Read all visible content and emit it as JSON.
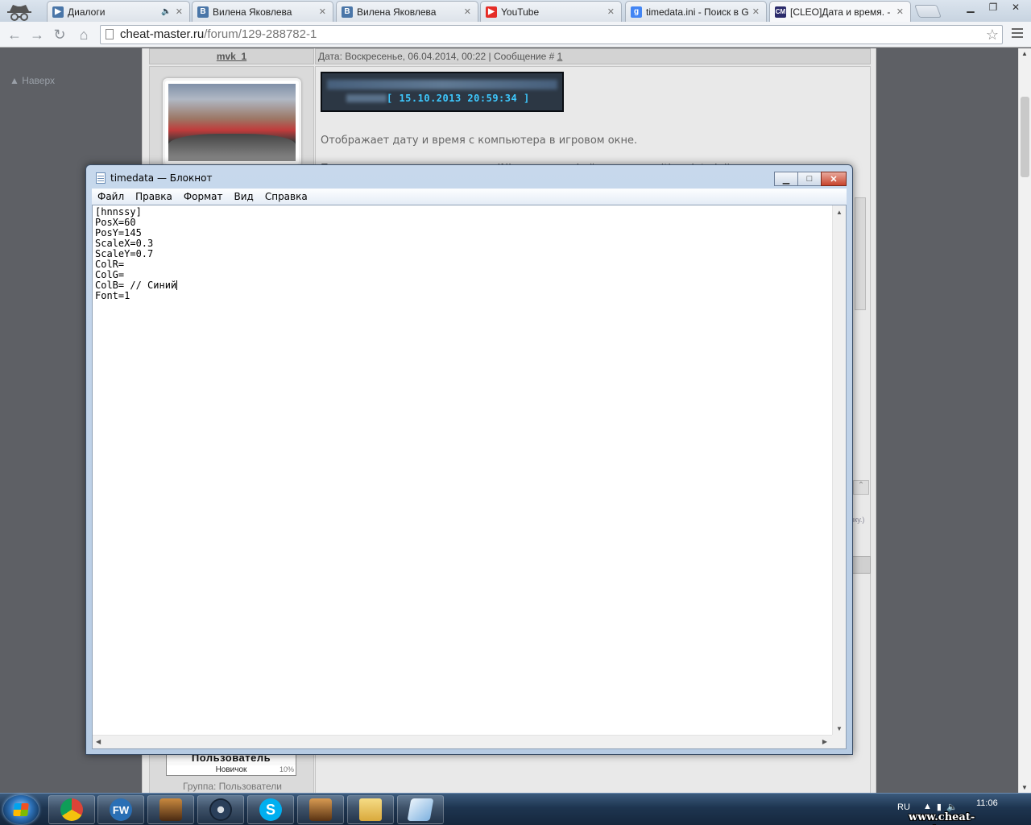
{
  "browser": {
    "tabs": [
      {
        "title": "Диалоги",
        "favicon_letter": "▶",
        "favicon_color": "#4a76a8"
      },
      {
        "title": "Вилена Яковлева",
        "favicon_letter": "В",
        "favicon_color": "#4a76a8"
      },
      {
        "title": "Вилена Яковлева",
        "favicon_letter": "В",
        "favicon_color": "#4a76a8"
      },
      {
        "title": "YouTube",
        "favicon_letter": "▶",
        "favicon_color": "#e52d27"
      },
      {
        "title": "timedata.ini - Поиск в Google",
        "favicon_letter": "g",
        "favicon_color": "#4285f4"
      },
      {
        "title": "[CLEO]Дата и время. - ",
        "favicon_letter": "CM",
        "favicon_color": "#2b2b6b"
      }
    ],
    "url_host": "cheat-master.ru",
    "url_path": "/forum/129-288782-1"
  },
  "page": {
    "top_link": "▲ Наверх",
    "post_author": "mvk_1",
    "post_meta": "Дата: Воскресенье, 06.04.2014, 00:22 | Сообщение # ",
    "post_number": "1",
    "banner_time": "[ 15.10.2013 20:59:34 ]",
    "post_line1": "Отображает дату и время с компьютера в игровом окне.",
    "post_line2": "После первого запуска в папке INI создастся файл настроек (timedata.ini), в котором вы сможете",
    "side_link": "лку.)",
    "rank_title": "Пользователь",
    "rank_level": "Новичок",
    "rank_pct": "10%",
    "group": "Группа: Пользователи"
  },
  "notepad": {
    "title": "timedata — Блокнот",
    "menu": [
      "Файл",
      "Правка",
      "Формат",
      "Вид",
      "Справка"
    ],
    "lines": [
      "[hnnssy]",
      "PosX=60",
      "PosY=145",
      "ScaleX=0.3",
      "ScaleY=0.7",
      "ColR=",
      "ColG=",
      "ColB= // Синий",
      "Font=1"
    ]
  },
  "taskbar": {
    "apps": [
      {
        "name": "chrome",
        "color": "#db4437"
      },
      {
        "name": "fw",
        "color": "#2a6fb5"
      },
      {
        "name": "gta-sa-1",
        "color": "#6b4a2a"
      },
      {
        "name": "steam",
        "color": "#2a3f5a"
      },
      {
        "name": "skype",
        "color": "#00aff0"
      },
      {
        "name": "gta-sa-2",
        "color": "#8a5a2a"
      },
      {
        "name": "explorer",
        "color": "#e8c35a"
      },
      {
        "name": "notepad",
        "color": "#7fb2e0"
      }
    ],
    "lang": "RU",
    "time": "11:06",
    "watermark": "www.cheat-master.ru"
  }
}
